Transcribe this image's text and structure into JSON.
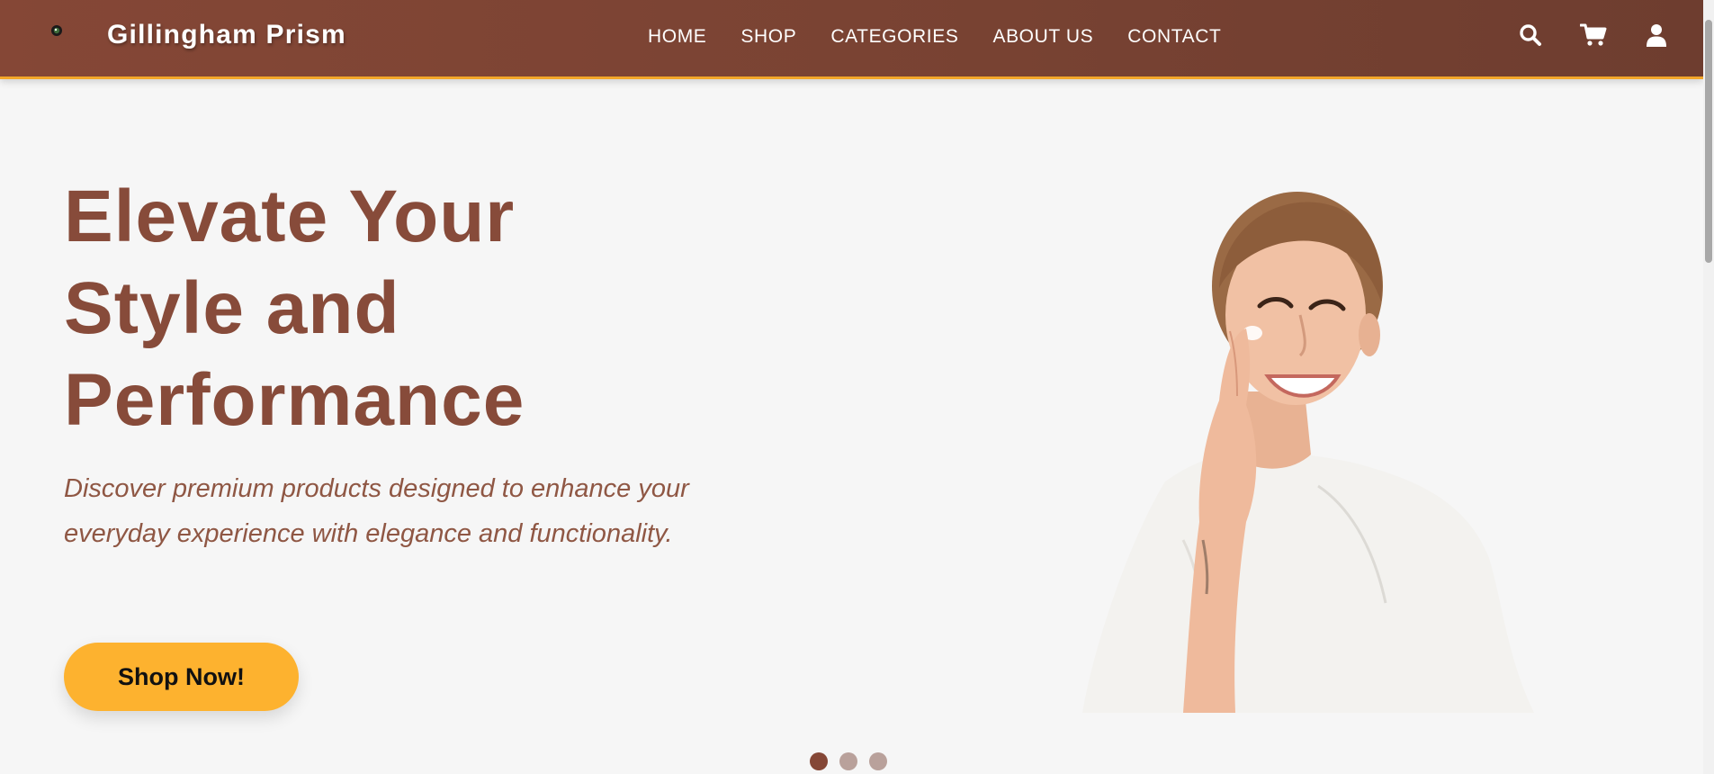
{
  "header": {
    "brand": "Gillingham Prism",
    "logo_icon": "eye-logo-icon",
    "nav": [
      "HOME",
      "SHOP",
      "CATEGORIES",
      "ABOUT US",
      "CONTACT"
    ],
    "icons": [
      "search-icon",
      "cart-icon",
      "user-icon"
    ]
  },
  "hero": {
    "title": "Elevate Your Style and Performance",
    "subtitle": "Discover premium products designed to enhance your everyday experience with elegance and functionality.",
    "cta_label": "Shop Now!",
    "image": "woman-applying-face-cream"
  },
  "carousel": {
    "slides": 3,
    "active": 1
  },
  "colors": {
    "header_bg": "#7a4333",
    "accent": "#fdb22f",
    "title": "#874b3a",
    "subtitle": "#8f5744",
    "page_bg": "#f6f6f6",
    "dot_active": "#854736",
    "dot_inactive": "#b9a19b"
  }
}
